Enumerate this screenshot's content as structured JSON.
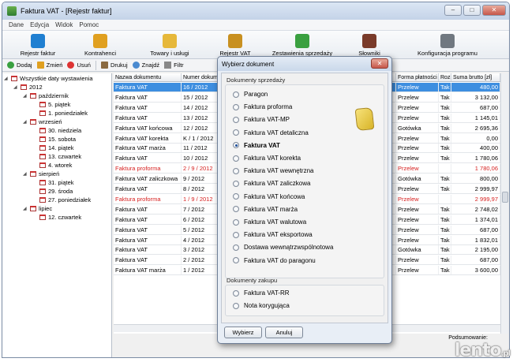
{
  "window": {
    "title": "Faktura VAT - [Rejestr faktur]"
  },
  "menu": [
    "Dane",
    "Edycja",
    "Widok",
    "Pomoc"
  ],
  "toolbar": [
    {
      "label": "Rejestr faktur",
      "color": "#1f7fd1"
    },
    {
      "label": "Kontrahenci",
      "color": "#e0a020"
    },
    {
      "label": "Towary i usługi",
      "color": "#e6b83a"
    },
    {
      "label": "Rejestr VAT",
      "color": "#c89020"
    },
    {
      "label": "Zestawienia sprzedaży",
      "color": "#3aa040"
    },
    {
      "label": "Słowniki",
      "color": "#7a3b2a"
    },
    {
      "label": "Konfiguracja programu",
      "color": "#707880"
    }
  ],
  "subbar": {
    "add": "Dodaj",
    "edit": "Zmień",
    "delete": "Usuń",
    "print": "Drukuj",
    "find": "Znajdź",
    "filter": "Filtr"
  },
  "tree": {
    "root": "Wszystkie daty wystawienia",
    "year": "2012",
    "months": [
      {
        "name": "październik",
        "days": [
          "5. piątek",
          "1. poniedziałek"
        ]
      },
      {
        "name": "wrzesień",
        "days": [
          "30. niedziela",
          "15. sobota",
          "14. piątek",
          "13. czwartek",
          "4. wtorek"
        ]
      },
      {
        "name": "sierpień",
        "days": [
          "31. piątek",
          "29. środa",
          "27. poniedziałek"
        ]
      },
      {
        "name": "lipiec",
        "days": [
          "12. czwartek"
        ]
      }
    ]
  },
  "grid": {
    "headers": [
      "Nazwa dokumentu",
      "Numer dokum",
      "Forma płatności",
      "Rozlic",
      "Suma brutto [zł]"
    ],
    "rows": [
      {
        "name": "Faktura VAT",
        "num": "16 / 2012",
        "pay": "Przelew",
        "rozl": "Tak",
        "sum": "480,00",
        "state": "sel"
      },
      {
        "name": "Faktura VAT",
        "num": "15 / 2012",
        "pay": "Przelew",
        "rozl": "Tak",
        "sum": "3 132,00",
        "state": ""
      },
      {
        "name": "Faktura VAT",
        "num": "14 / 2012",
        "pay": "Przelew",
        "rozl": "Tak",
        "sum": "687,00",
        "state": ""
      },
      {
        "name": "Faktura VAT",
        "num": "13 / 2012",
        "pay": "Przelew",
        "rozl": "Tak",
        "sum": "1 145,01",
        "state": ""
      },
      {
        "name": "Faktura VAT końcowa",
        "num": "12 / 2012",
        "pay": "Gotówka",
        "rozl": "Tak",
        "sum": "2 695,36",
        "state": ""
      },
      {
        "name": "Faktura VAT korekta",
        "num": "K / 1 / 2012",
        "pay": "Przelew",
        "rozl": "Tak",
        "sum": "0,00",
        "state": ""
      },
      {
        "name": "Faktura VAT marża",
        "num": "11 / 2012",
        "pay": "Przelew",
        "rozl": "Tak",
        "sum": "400,00",
        "state": ""
      },
      {
        "name": "Faktura VAT",
        "num": "10 / 2012",
        "pay": "Przelew",
        "rozl": "Tak",
        "sum": "1 780,06",
        "state": ""
      },
      {
        "name": "Faktura proforma",
        "num": "2 / 9 / 2012",
        "pay": "Przelew",
        "rozl": "",
        "sum": "1 780,06",
        "state": "red"
      },
      {
        "name": "Faktura VAT zaliczkowa",
        "num": "9 / 2012",
        "pay": "Gotówka",
        "rozl": "Tak",
        "sum": "800,00",
        "state": ""
      },
      {
        "name": "Faktura VAT",
        "num": "8 / 2012",
        "pay": "Przelew",
        "rozl": "Tak",
        "sum": "2 999,97",
        "state": ""
      },
      {
        "name": "Faktura proforma",
        "num": "1 / 9 / 2012",
        "pay": "Przelew",
        "rozl": "",
        "sum": "2 999,97",
        "state": "red"
      },
      {
        "name": "Faktura VAT",
        "num": "7 / 2012",
        "pay": "Przelew",
        "rozl": "Tak",
        "sum": "2 748,02",
        "state": ""
      },
      {
        "name": "Faktura VAT",
        "num": "6 / 2012",
        "pay": "Przelew",
        "rozl": "Tak",
        "sum": "1 374,01",
        "state": ""
      },
      {
        "name": "Faktura VAT",
        "num": "5 / 2012",
        "pay": "Przelew",
        "rozl": "Tak",
        "sum": "687,00",
        "state": ""
      },
      {
        "name": "Faktura VAT",
        "num": "4 / 2012",
        "pay": "Przelew",
        "rozl": "Tak",
        "sum": "1 832,01",
        "state": ""
      },
      {
        "name": "Faktura VAT",
        "num": "3 / 2012",
        "pay": "Gotówka",
        "rozl": "Tak",
        "sum": "2 195,00",
        "state": ""
      },
      {
        "name": "Faktura VAT",
        "num": "2 / 2012",
        "pay": "Przelew",
        "rozl": "Tak",
        "sum": "687,00",
        "state": ""
      },
      {
        "name": "Faktura VAT marża",
        "num": "1 / 2012",
        "pay": "Przelew",
        "rozl": "Tak",
        "sum": "3 600,00",
        "state": ""
      }
    ]
  },
  "summary": {
    "label": "Podsumowanie:",
    "watermark": "lento",
    "watermark_suffix": ".pl"
  },
  "dialog": {
    "title": "Wybierz dokument",
    "sales_section": "Dokumenty sprzedaży",
    "sales_options": [
      "Paragon",
      "Faktura proforma",
      "Faktura VAT-MP",
      "Faktura VAT detaliczna",
      "Faktura VAT",
      "Faktura VAT korekta",
      "Faktura VAT wewnętrzna",
      "Faktura VAT zaliczkowa",
      "Faktura VAT końcowa",
      "Faktura VAT marża",
      "Faktura VAT walutowa",
      "Faktura VAT eksportowa",
      "Dostawa wewnątrzwspólnotowa",
      "Faktura VAT do paragonu"
    ],
    "selected_index": 4,
    "purchase_section": "Dokumenty zakupu",
    "purchase_options": [
      "Faktura VAT-RR",
      "Nota korygująca"
    ],
    "ok_label": "Wybierz",
    "cancel_label": "Anuluj"
  }
}
